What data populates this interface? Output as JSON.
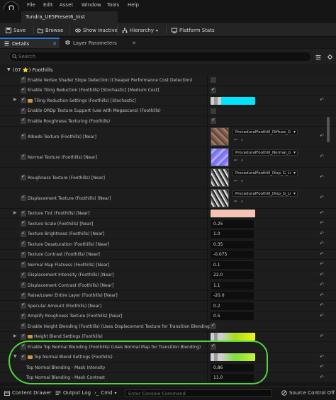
{
  "menu": {
    "items": [
      "File",
      "Edit",
      "Asset",
      "Window",
      "Tools",
      "Help"
    ]
  },
  "window": {
    "tab_title": "Tundra_UE5Preset6_Inst"
  },
  "toolbar": {
    "save_label": "Save",
    "browse_label": "Browse",
    "show_inactive_label": "Show Inactive",
    "hierarchy_label": "Hierarchy",
    "platform_stats_label": "Platform Stats"
  },
  "panel_tabs": {
    "details_label": "Details",
    "layer_parameters_label": "Layer Parameters"
  },
  "search": {
    "placeholder": "Search"
  },
  "category": {
    "label": "(07 ⭐) Foothills"
  },
  "rows": [
    {
      "label": "Enable Vertex Shader Slope Detection (Cheaper Performance Cost Detection)",
      "kind": "bool",
      "value": false
    },
    {
      "label": "Enable Tiling Reduction (Foothills) [Stochastic] [Medium Cost]",
      "kind": "bool",
      "value": true
    },
    {
      "label": "Tiling Reduction Settings (Foothills) [Stochastic]",
      "kind": "gradient",
      "gradient": "cyan"
    },
    {
      "label": "Enable ORDp Texture Support (use with Megascans) (Foothills)",
      "kind": "bool",
      "value": false
    },
    {
      "label": "Enable Roughness Texturing (Foothills)",
      "kind": "bool",
      "value": true
    },
    {
      "label": "Albedo Texture (Foothills) [Near]",
      "kind": "texture",
      "texture": "ProceduralFoothill_Diffuse_G",
      "thumb": "albedo"
    },
    {
      "label": "Normal Texture (Foothills) [Near]",
      "kind": "texture",
      "texture": "ProceduralFoothill_Normal_G",
      "thumb": "normal"
    },
    {
      "label": "Roughness Texture (Foothills) [Near]",
      "kind": "texture",
      "texture": "ProceduralFoothill_Disp_G_LC",
      "thumb": "gray"
    },
    {
      "label": "Displacement Texture (Foothills) [Near]",
      "kind": "texture",
      "texture": "ProceduralFoothill_Disp_G_LC",
      "thumb": "gray"
    },
    {
      "label": "Texture Tint (Foothills) [Near]",
      "kind": "color",
      "color": "#f4c3b3"
    },
    {
      "label": "Texture Scale (Foothills) [Near]",
      "kind": "number",
      "value": "0.25"
    },
    {
      "label": "Texture Brightness (Foothills) [Near]",
      "kind": "number",
      "value": "1.0"
    },
    {
      "label": "Texture Desaturation (Foothills) [Near]",
      "kind": "number",
      "value": "0.35"
    },
    {
      "label": "Texture Contrast (Foothills) [Near]",
      "kind": "number",
      "value": "-0.075"
    },
    {
      "label": "Normal Map Flatness (Foothills) [Near]",
      "kind": "number",
      "value": "0.1"
    },
    {
      "label": "Displacement Intensity (Foothills) [Near]",
      "kind": "number",
      "value": "22.0"
    },
    {
      "label": "Displacement Contrast (Foothills) [Near]",
      "kind": "number",
      "value": "1.1"
    },
    {
      "label": "Raise/Lower Entire Layer (Foothills) [Near]",
      "kind": "number",
      "value": "-20.0"
    },
    {
      "label": "Specular Amount (Foothills) [Near]",
      "kind": "number",
      "value": "0.2"
    },
    {
      "label": "Amplify Roughness Texture (Foothills) [Near]",
      "kind": "number",
      "value": "0.5"
    },
    {
      "label": "Enable Height Blending (Foothills) (Uses Displacement Texture for Transition Blending)",
      "kind": "bool",
      "value": true
    },
    {
      "label": "Height Blend Settings (Foothills)",
      "kind": "gradient",
      "gradient": "yellow"
    },
    {
      "label": "Enable Top Normal Blending (Foothills) (Uses Normal Map for Transition Blending)",
      "kind": "bool",
      "value": true
    },
    {
      "label": "Top Normal Blend Settings (Foothills)",
      "kind": "gradient",
      "gradient": "green"
    },
    {
      "label": "Top Normal Blending - Mask Intensity",
      "kind": "subnumber",
      "value": "0.86"
    },
    {
      "label": "Top Normal Blending - Mask Contrast",
      "kind": "subnumber",
      "value": "11.0"
    }
  ],
  "statusbar": {
    "content_drawer_label": "Content Drawer",
    "output_log_label": "Output Log",
    "cmd_label": "Cmd",
    "console_placeholder": "Enter Console Command",
    "source_control_label": "Source Control Off"
  },
  "colors": {
    "accent": "#2677d6",
    "highlight": "#4ed63b",
    "folder": "#c79b3b"
  }
}
